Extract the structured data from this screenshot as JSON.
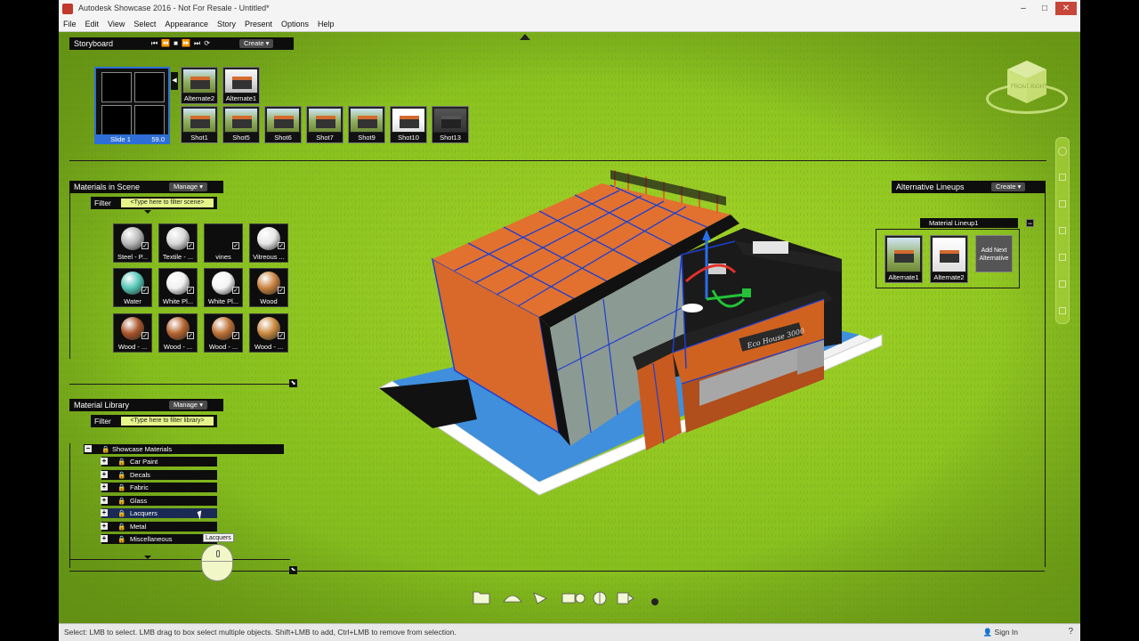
{
  "window": {
    "title": "Autodesk Showcase 2016 - Not For Resale - Untitled*",
    "minimize": "–",
    "maximize": "□",
    "close": "✕"
  },
  "menu": [
    "File",
    "Edit",
    "View",
    "Select",
    "Appearance",
    "Story",
    "Present",
    "Options",
    "Help"
  ],
  "storyboard": {
    "title": "Storyboard",
    "controls": [
      "⏮",
      "⏪",
      "■",
      "⏩",
      "⏭",
      "⟳"
    ],
    "create_label": "Create",
    "slide": {
      "label": "Slide 1",
      "time": "59.0"
    },
    "alternates": [
      "Alternate2",
      "Alternate1"
    ],
    "shots": [
      "Shot1",
      "Shot5",
      "Shot6",
      "Shot7",
      "Shot9",
      "Shot10",
      "Shot13"
    ]
  },
  "materials_in_scene": {
    "title": "Materials in Scene",
    "manage_label": "Manage",
    "filter_label": "Filter",
    "filter_placeholder": "<Type here to filter scene>",
    "items": [
      {
        "label": "Steel - P...",
        "color": "#b9b9b9"
      },
      {
        "label": "Textile - ...",
        "color": "#d8d8d8"
      },
      {
        "label": "vines",
        "color": "#0d0d0d"
      },
      {
        "label": "Vitreous ...",
        "color": "#e6e6e6"
      },
      {
        "label": "Water",
        "color": "#55c7b6"
      },
      {
        "label": "White Pl...",
        "color": "#f0f0f0"
      },
      {
        "label": "White Pl...",
        "color": "#f4f4f4"
      },
      {
        "label": "Wood",
        "color": "#c8813e"
      },
      {
        "label": "Wood - ...",
        "color": "#a9542a"
      },
      {
        "label": "Wood - ...",
        "color": "#b4622e"
      },
      {
        "label": "Wood - ...",
        "color": "#bd7034"
      },
      {
        "label": "Wood - ...",
        "color": "#c9893f"
      }
    ]
  },
  "material_library": {
    "title": "Material Library",
    "manage_label": "Manage",
    "filter_label": "Filter",
    "filter_placeholder": "<Type here to filter library>",
    "root": "Showcase Materials",
    "categories": [
      "Car Paint",
      "Decals",
      "Fabric",
      "Glass",
      "Lacquers",
      "Metal",
      "Miscellaneous"
    ],
    "tooltip": "Lacquers"
  },
  "alternative_lineups": {
    "title": "Alternative Lineups",
    "create_label": "Create",
    "lineup_name": "Material Lineup1",
    "items": [
      "Alternate1",
      "Alternate2"
    ],
    "add_next": "Add Next Alternative"
  },
  "viewcube": {
    "front": "FRONT",
    "right": "RIGHT"
  },
  "building": {
    "sign_text": "Eco House 3000"
  },
  "status": {
    "message": "Select: LMB to select. LMB drag to box select multiple objects. Shift+LMB to add, Ctrl+LMB to remove from selection.",
    "signin": "Sign In",
    "help": "?"
  },
  "colors": {
    "grass": "#88c01f",
    "panel_bg": "#0d0d0d",
    "accent_yellow": "#e6f58a",
    "selection_blue": "#2d6fd6",
    "roof_orange": "#e2712f"
  }
}
